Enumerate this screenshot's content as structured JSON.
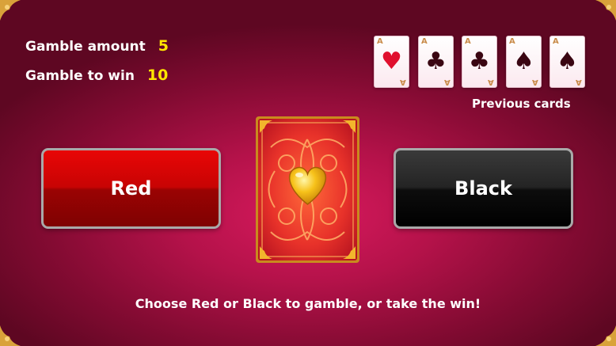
{
  "gamble": {
    "amount_label": "Gamble amount",
    "amount_value": "5",
    "to_win_label": "Gamble to win",
    "to_win_value": "10"
  },
  "previous_cards": {
    "caption": "Previous cards",
    "cards": [
      {
        "rank": "A",
        "suit": "♥",
        "color": "red"
      },
      {
        "rank": "A",
        "suit": "♣",
        "color": "black"
      },
      {
        "rank": "A",
        "suit": "♣",
        "color": "black"
      },
      {
        "rank": "A",
        "suit": "♠",
        "color": "black"
      },
      {
        "rank": "A",
        "suit": "♠",
        "color": "black"
      }
    ]
  },
  "buttons": {
    "red_label": "Red",
    "black_label": "Black"
  },
  "center_card": {
    "icon": "heart-icon",
    "face": "back"
  },
  "instruction": "Choose Red or Black to gamble, or take the win!",
  "colors": {
    "background": "#b5124a",
    "value_yellow": "#ffe600",
    "red_button": "#d60505",
    "black_button": "#1a1a1a"
  }
}
